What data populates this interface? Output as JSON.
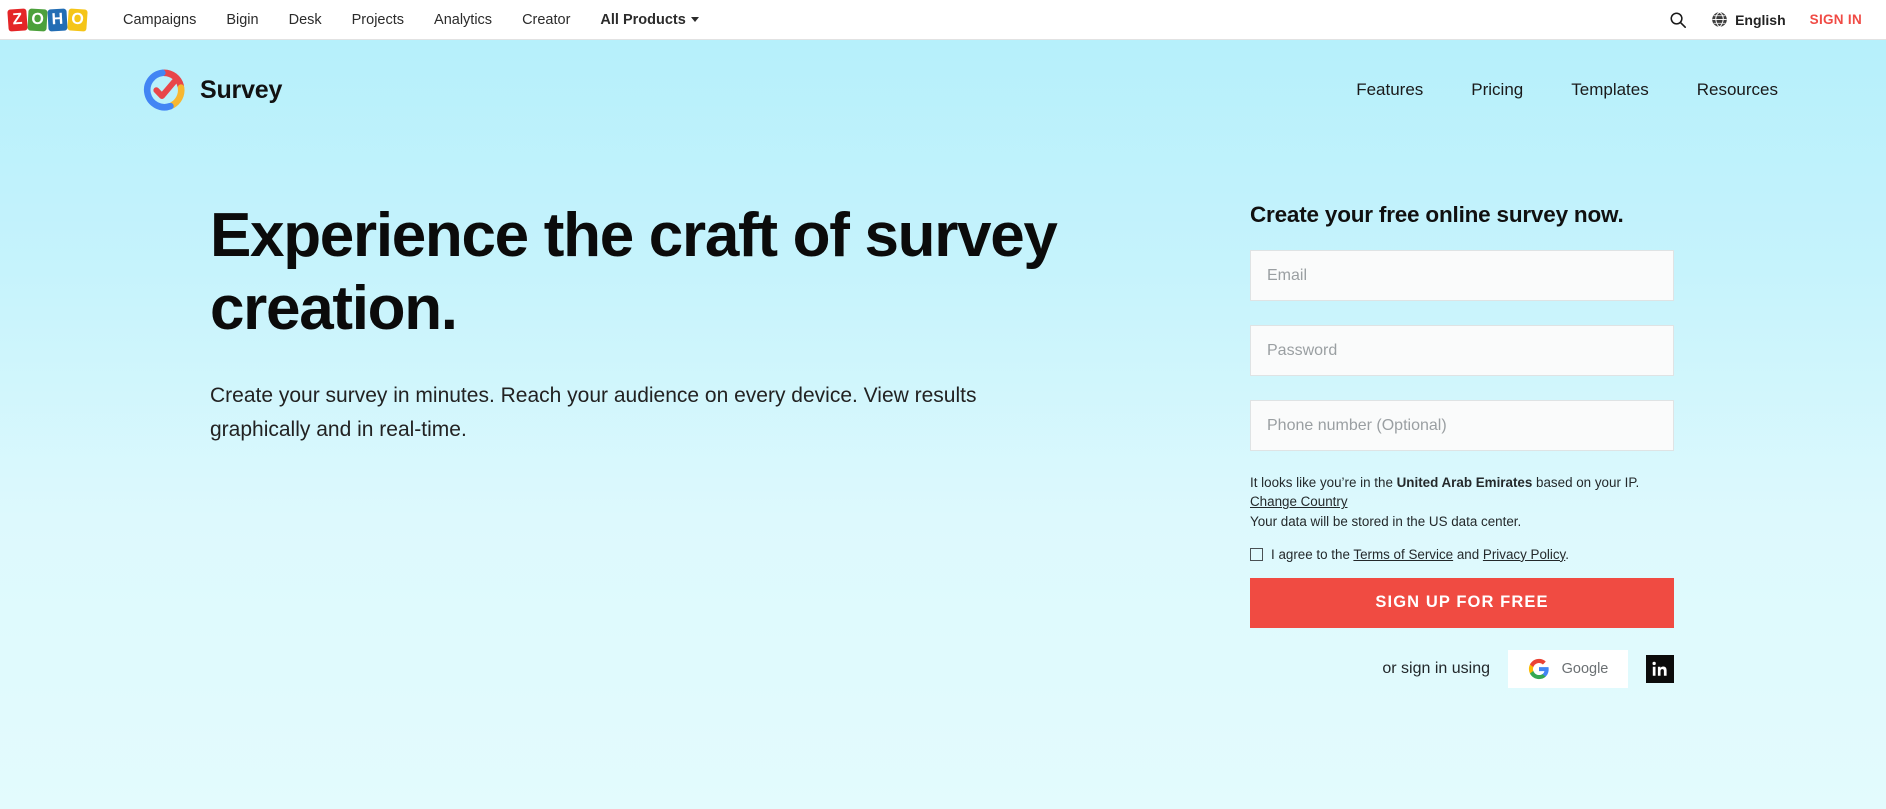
{
  "zoho_bar": {
    "logo_letters": [
      "Z",
      "O",
      "H",
      "O"
    ],
    "logo_name": "zoho-logo",
    "nav": [
      {
        "label": "Campaigns"
      },
      {
        "label": "Bigin"
      },
      {
        "label": "Desk"
      },
      {
        "label": "Projects"
      },
      {
        "label": "Analytics"
      },
      {
        "label": "Creator"
      }
    ],
    "all_products": "All Products",
    "search_icon": "search-icon",
    "globe_icon": "globe-icon",
    "language": "English",
    "sign_in": "SIGN IN",
    "accent_red": "#f04b45"
  },
  "product_header": {
    "brand_name": "Survey",
    "logo_icon": "survey-check-circle-icon",
    "logo_colors": {
      "red": "#e8464a",
      "blue": "#4285f4",
      "yellow": "#f7b731"
    },
    "nav": [
      {
        "label": "Features"
      },
      {
        "label": "Pricing"
      },
      {
        "label": "Templates"
      },
      {
        "label": "Resources"
      }
    ]
  },
  "hero": {
    "title": "Experience the craft of survey creation.",
    "subtitle": "Create your survey in minutes. Reach your audience on every device. View results graphically and in real-time.",
    "background_top": "#b6f0fb",
    "background_bottom": "#e3fbfd"
  },
  "signup": {
    "heading": "Create your free online survey now.",
    "fields": [
      {
        "name": "email-field",
        "placeholder": "Email",
        "value": ""
      },
      {
        "name": "password-field",
        "placeholder": "Password",
        "value": ""
      },
      {
        "name": "phone-field",
        "placeholder": "Phone number (Optional)",
        "value": ""
      }
    ],
    "ip_note_prefix": "It looks like you’re in the ",
    "ip_note_country": "United Arab Emirates",
    "ip_note_suffix": " based on your IP. ",
    "change_country_link": "Change Country",
    "datacenter_note": "Your data will be stored in the US data center.",
    "terms_prefix": "I agree to the ",
    "terms_link": "Terms of Service",
    "terms_conjunction": " and ",
    "privacy_link": "Privacy Policy",
    "terms_suffix": ".",
    "checkbox_checked": false,
    "submit_label": "SIGN UP FOR FREE",
    "submit_color": "#f04b42",
    "social_label": "or sign in using",
    "google_label": "Google",
    "google_icon": "google-g-icon",
    "linkedin_icon": "linkedin-icon"
  }
}
